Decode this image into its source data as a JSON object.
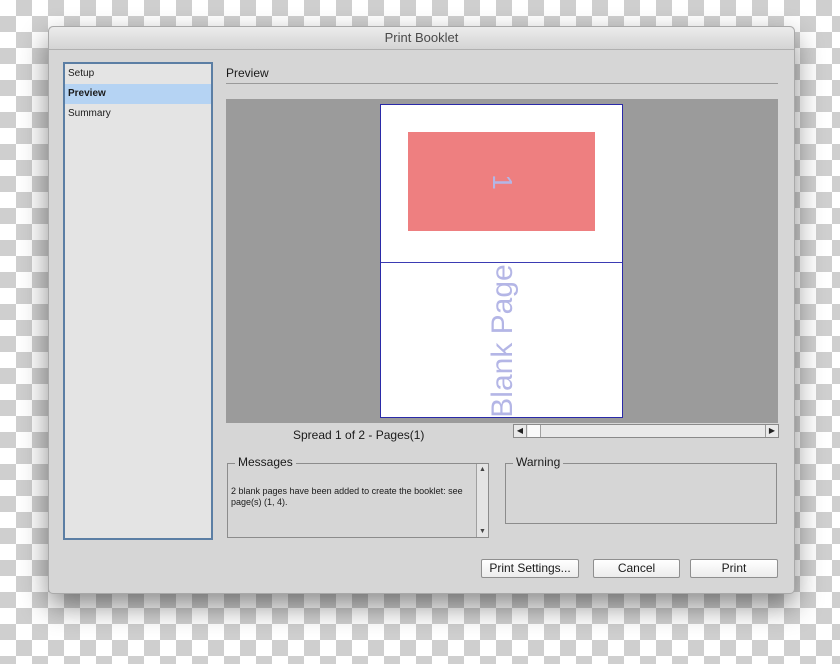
{
  "window": {
    "title": "Print Booklet"
  },
  "sidebar": {
    "items": [
      {
        "label": "Setup"
      },
      {
        "label": "Preview"
      },
      {
        "label": "Summary"
      }
    ],
    "selected": "Preview"
  },
  "main": {
    "section_title": "Preview",
    "preview": {
      "page_number": "1",
      "blank_page_label": "Blank Page",
      "spread_label": "Spread 1 of 2 - Pages(1)"
    },
    "messages": {
      "title": "Messages",
      "text": "2 blank pages have been added to create the booklet: see page(s) (1, 4)."
    },
    "warning": {
      "title": "Warning",
      "text": ""
    }
  },
  "buttons": {
    "print_settings": "Print Settings...",
    "cancel": "Cancel",
    "print": "Print"
  },
  "icons": {
    "scroll_left": "scroll-left-arrow-icon",
    "scroll_right": "scroll-right-arrow-icon",
    "scroll_up": "scroll-up-arrow-icon",
    "scroll_down": "scroll-down-arrow-icon"
  },
  "colors": {
    "selection": "#b5d3f3",
    "sidebar_border": "#5b7ea4",
    "page_block": "#ee7f80",
    "page_label": "#b4b6e6",
    "preview_background": "#9b9b9b"
  }
}
